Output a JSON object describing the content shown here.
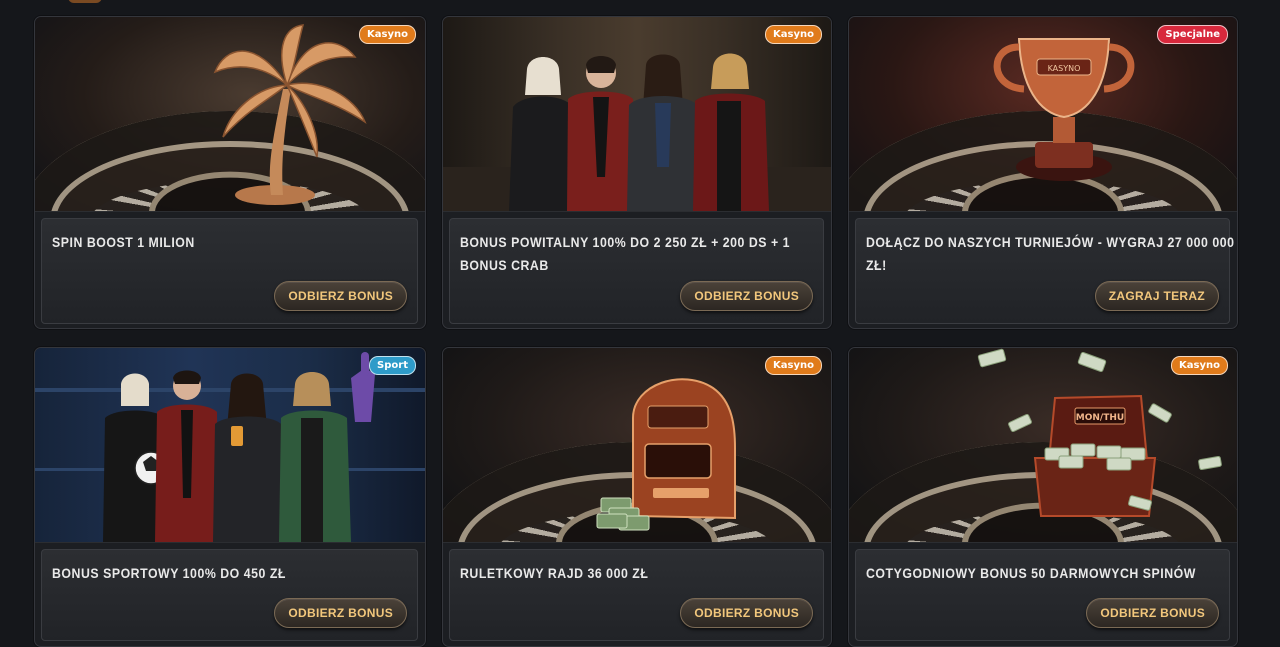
{
  "promotions": [
    {
      "badge": "Kasyno",
      "title": "SPIN BOOST 1 MILION",
      "cta": "ODBIERZ BONUS"
    },
    {
      "badge": "Kasyno",
      "title": "BONUS POWITALNY 100% DO 2 250 ZŁ + 200 DS + 1 BONUS CRAB",
      "cta": "ODBIERZ BONUS"
    },
    {
      "badge": "Specjalne",
      "title": "DOŁĄCZ DO NASZYCH TURNIEJÓW - WYGRAJ 27 000 000 ZŁ!",
      "cta": "ZAGRAJ TERAZ"
    },
    {
      "badge": "Sport",
      "title": "BONUS SPORTOWY 100% DO 450 ZŁ",
      "cta": "ODBIERZ BONUS"
    },
    {
      "badge": "Kasyno",
      "title": "RULETKOWY RAJD 36 000 ZŁ",
      "cta": "ODBIERZ BONUS"
    },
    {
      "badge": "Kasyno",
      "title": "COTYGODNIOWY BONUS 50 DARMOWYCH SPINÓW",
      "cta": "ODBIERZ BONUS"
    }
  ],
  "images": {
    "trophy_engraving": "KASYNO",
    "suitcase_label": "MON/THU"
  },
  "colors": {
    "kasyno_badge": "#e07b1b",
    "specjalne_badge": "#d8283c",
    "sport_badge": "#2e9bc9",
    "cta_text": "#f2c77c",
    "page_bg": "#15171b"
  },
  "icons": [
    "palm-tree-icon",
    "trophy-icon",
    "slot-machine-icon",
    "money-suitcase-icon",
    "soccer-ball-icon"
  ]
}
